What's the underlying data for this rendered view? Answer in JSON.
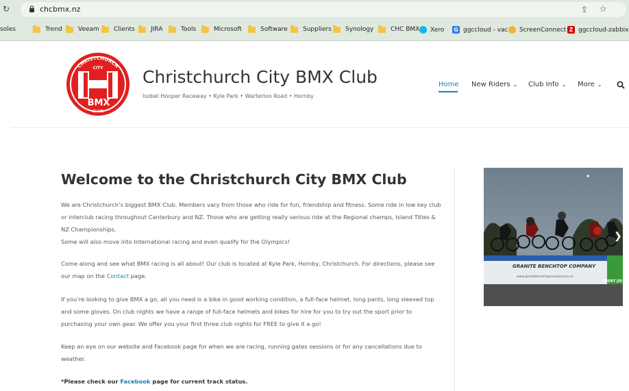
{
  "browser": {
    "url": "chcbmx.nz",
    "bookmarks": [
      {
        "label": "soles",
        "kind": "text"
      },
      {
        "label": "Trend",
        "kind": "folder"
      },
      {
        "label": "Veeam",
        "kind": "folder"
      },
      {
        "label": "Clients",
        "kind": "folder"
      },
      {
        "label": "JIRA",
        "kind": "folder"
      },
      {
        "label": "Tools",
        "kind": "folder"
      },
      {
        "label": "Microsoft",
        "kind": "folder"
      },
      {
        "label": "Software",
        "kind": "folder"
      },
      {
        "label": "Suppliers",
        "kind": "folder"
      },
      {
        "label": "Synology",
        "kind": "folder"
      },
      {
        "label": "CHC BMX",
        "kind": "folder"
      },
      {
        "label": "Xero",
        "kind": "xero-icon"
      },
      {
        "label": "ggccloud - vac",
        "kind": "ggc-icon"
      },
      {
        "label": "ScreenConnect",
        "kind": "screenconnect-icon"
      },
      {
        "label": "ggccloud-zabbix",
        "kind": "zabbix-icon"
      }
    ]
  },
  "site": {
    "title": "Christchurch City BMX Club",
    "tagline": "Isobel Hooper Raceway • Kyle Park • Warterloo Road • Hornby",
    "logo_text": {
      "top": "CHRISTCHURCH",
      "mid": "CITY",
      "bmx": "BMX",
      "club": "CLUB"
    }
  },
  "nav": {
    "home": "Home",
    "new_riders": "New Riders",
    "club_info": "Club Info",
    "more": "More",
    "chevron": "❯"
  },
  "content": {
    "heading": "Welcome to the Christchurch City BMX Club",
    "p1": "We are Christchurch’s biggest BMX Club. Members vary from those who ride for fun, friendship and fitness. Some ride in low key club or interclub racing throughout Canterbury and NZ. Those who are getting really serious ride at the Regional champs, Island Titles & NZ Championships.",
    "p1b": "Some will also move into International racing and even qualify for the Olympics!",
    "p2_before": "Come along and see what BMX racing is all about! Our club is located at Kyle Park, Hornby, Christchurch. For directions, please see our map on the ",
    "p2_link": "Contact",
    "p2_after": " page.",
    "p3": "If you’re looking to give BMX a go, all you need is a bike in good working condition, a full-face helmet, long pants, long sleeved top and some gloves. On club nights we have a range of full-face helmets and bikes for hire for you to try out the sport prior to purchasing your own gear. We offer you your first three club nights for FREE to give it a go!",
    "p4": "Keep an eye on our website and Facebook page for when we are racing, running gates sessions or for any cancellations due to weather.",
    "p5_before": "*Please check our ",
    "p5_link": "Facebook",
    "p5_after": " page for current track status."
  },
  "photo": {
    "banner_text": "GRANITE BENCHTOP COMPANY",
    "banner_url": "www.granitebenchtopcompany.co.nz",
    "trent_text": "TRENT JOI"
  },
  "colors": {
    "accent": "#1a7fb5",
    "logo_red": "#e02020",
    "chrome": "#dfe9df"
  }
}
